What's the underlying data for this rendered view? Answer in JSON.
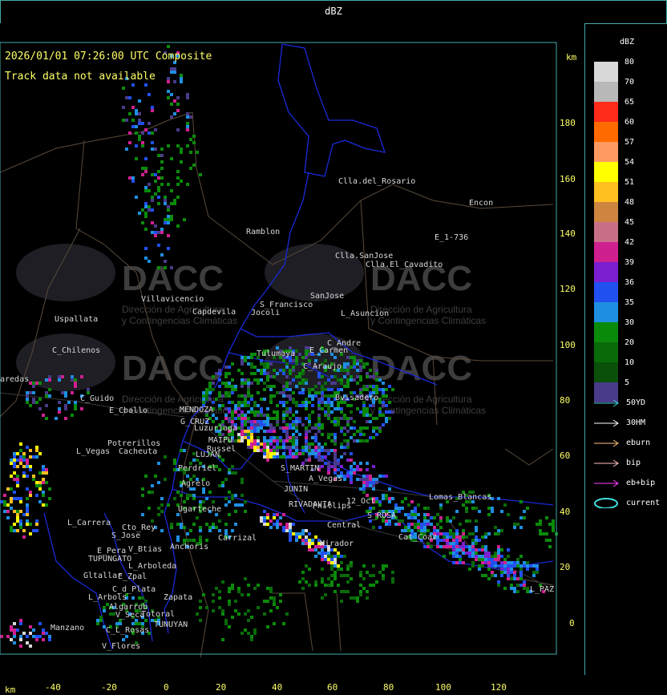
{
  "header": {
    "title": "dBZ"
  },
  "map": {
    "timestamp": "2026/01/01 07:26:00 UTC Composite",
    "track_note": "Track data not available",
    "unit_top": "km",
    "unit_bottom": "km",
    "y_ticks": [
      "180",
      "160",
      "140",
      "120",
      "100",
      "80",
      "60",
      "40",
      "20",
      "0"
    ],
    "x_ticks": [
      "-40",
      "-20",
      "0",
      "20",
      "40",
      "60",
      "80",
      "100",
      "120"
    ],
    "watermark": {
      "brand": "DACC",
      "line1": "Dirección de Agricultura",
      "line2": "y Contingencias Climáticas"
    },
    "places": [
      "Clla.del_Rosario",
      "Encon",
      "Ramblon",
      "E_1-736",
      "Clla.SanJose",
      "Clla.El_Cavadito",
      "Villavicencio",
      "Capdevila",
      "S_Francisco",
      "SanJose",
      "L_Asuncion",
      "Uspallata",
      "C_Chilenos",
      "C_Andre",
      "E_Carmen",
      "Jocoli",
      "Tulumaya",
      "C_Araujo",
      "Bvisadero",
      "C_Guido",
      "E_Cballo",
      "MENDOZA",
      "G_CRUZ",
      "Luzuriaga",
      "Potrerillos",
      "L_Vegas",
      "Cacheuta",
      "MAIPU",
      "Russel",
      "LUJAN",
      "Perdriel",
      "S_MARTIN",
      "A_Vegas",
      "Agrelo",
      "JUNIN",
      "Ugarteche",
      "RIVADAVIA",
      "Phillips",
      "12_Oct",
      "S_ROSA",
      "Lomas_Blancas",
      "L_Carrera",
      "Cto_Rey",
      "S_Jose",
      "Carrizal",
      "Central",
      "Mirador",
      "E_Pera",
      "TUPUNGATO",
      "V_Btias",
      "Anchoris",
      "L_Arboleda",
      "Gltallar",
      "E_Zpal",
      "C_d_Plata",
      "L_Arbols",
      "Algarrob",
      "Zapata",
      "V_Seca",
      "Totoral",
      "TUNUYAN",
      "Manzano",
      "C_L_Rosas",
      "V_Flores",
      "L_PAZ",
      "Cat_Coaz",
      "aredas"
    ]
  },
  "legend": {
    "title": "dBZ",
    "scale": [
      {
        "label": "80",
        "color": "#d8d8d8"
      },
      {
        "label": "70",
        "color": "#b8b8b8"
      },
      {
        "label": "65",
        "color": "#ff2a1a"
      },
      {
        "label": "60",
        "color": "#ff6a00"
      },
      {
        "label": "57",
        "color": "#ff9a60"
      },
      {
        "label": "54",
        "color": "#ffff00"
      },
      {
        "label": "51",
        "color": "#ffc020"
      },
      {
        "label": "48",
        "color": "#cd853f"
      },
      {
        "label": "45",
        "color": "#c87088"
      },
      {
        "label": "42",
        "color": "#d02090"
      },
      {
        "label": "39",
        "color": "#7a1fd0"
      },
      {
        "label": "36",
        "color": "#2050f0"
      },
      {
        "label": "35",
        "color": "#1e8fe0"
      },
      {
        "label": "30",
        "color": "#0a8a0a"
      },
      {
        "label": "20",
        "color": "#0a6a0a"
      },
      {
        "label": "10",
        "color": "#0a500a"
      },
      {
        "label": "5",
        "color": "#4a3a8a"
      }
    ],
    "tracks": [
      {
        "label": "50YD",
        "color": "#40d0d0"
      },
      {
        "label": "30HM",
        "color": "#ffffff"
      },
      {
        "label": "eburn",
        "color": "#ffc080"
      },
      {
        "label": "bip",
        "color": "#ffc0c0"
      },
      {
        "label": "eb+bip",
        "color": "#ff40ff"
      },
      {
        "label": "current",
        "color": "#40e0e0"
      }
    ]
  }
}
